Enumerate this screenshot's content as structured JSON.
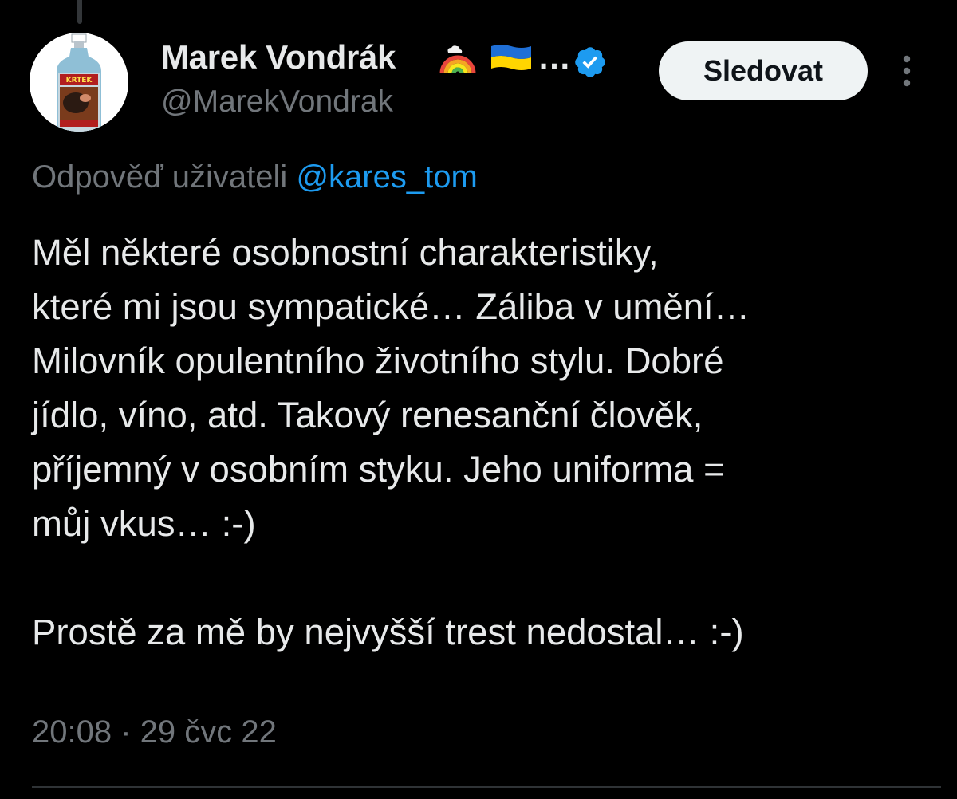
{
  "tweet": {
    "author": {
      "display_name": "Marek Vondrák",
      "name_emojis": [
        "rainbow",
        "ukraine-flag"
      ],
      "name_truncation": "…",
      "handle": "@MarekVondrak",
      "verified": true,
      "avatar_label": "KRTEK"
    },
    "follow_label": "Sledovat",
    "reply_to": {
      "prefix": "Odpověď uživateli",
      "mention": "@kares_tom"
    },
    "text_lines": [
      "Měl některé osobnostní charakteristiky,",
      "které mi jsou sympatické… Záliba v umění…",
      "Milovník opulentního životního stylu. Dobré",
      "jídlo, víno, atd. Takový renesanční člověk,",
      "příjemný v osobním styku. Jeho uniforma =",
      "můj vkus… :-)"
    ],
    "text_last_paragraph": "Prostě za mě by nejvyšší trest nedostal… :-)",
    "timestamp": "20:08 · 29 čvc 22"
  },
  "colors": {
    "background": "#000000",
    "text": "#e7e9ea",
    "secondary": "#71767b",
    "accent": "#1d9bf0",
    "button_bg": "#eff3f4"
  }
}
